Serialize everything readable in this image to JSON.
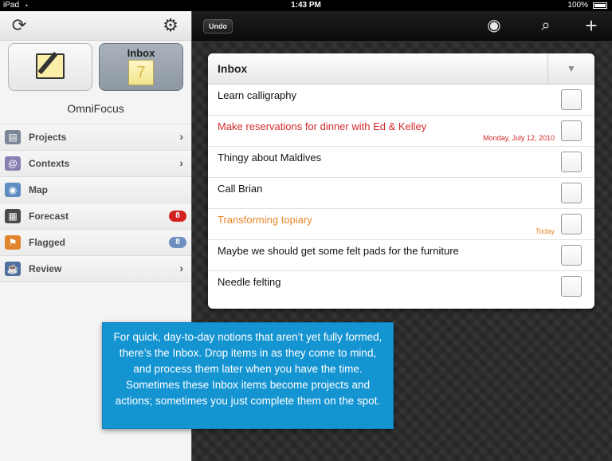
{
  "status_bar": {
    "carrier": "iPad",
    "wifi_icon": "wifi-icon",
    "time": "1:43 PM",
    "battery": "100%"
  },
  "sidebar": {
    "toolbar": {
      "sync_icon": "sync-icon",
      "settings_icon": "gear-icon"
    },
    "tiles": {
      "inbox_label": "Inbox",
      "inbox_count": "7"
    },
    "app_name": "OmniFocus",
    "perspectives": [
      {
        "label": "Projects",
        "icon": "projects-icon",
        "icon_color": "#7a8796",
        "trailing": "chevron"
      },
      {
        "label": "Contexts",
        "icon": "contexts-icon",
        "icon_color": "#8a7fb0",
        "trailing": "chevron"
      },
      {
        "label": "Map",
        "icon": "map-icon",
        "icon_color": "#5f8dc0",
        "trailing": ""
      },
      {
        "label": "Forecast",
        "icon": "forecast-icon",
        "icon_color": "#4a4a4a",
        "badge": "8",
        "badge_color": "#d32020"
      },
      {
        "label": "Flagged",
        "icon": "flag-icon",
        "icon_color": "#e0852e",
        "badge": "8",
        "badge_color": "#6d8fbf"
      },
      {
        "label": "Review",
        "icon": "review-icon",
        "icon_color": "#4f6f9f",
        "trailing": "chevron"
      }
    ]
  },
  "main": {
    "toolbar": {
      "undo_label": "Undo",
      "view_icon": "eye-icon",
      "search_icon": "search-icon",
      "add_icon": "plus-icon"
    },
    "panel": {
      "title": "Inbox",
      "tasks": [
        {
          "title": "Learn calligraphy",
          "date": "",
          "color": "#111111"
        },
        {
          "title": "Make reservations for dinner with Ed & Kelley",
          "date": "Monday, July 12, 2010",
          "color": "#d42a2a"
        },
        {
          "title": "Thingy about Maldives",
          "date": "",
          "color": "#111111"
        },
        {
          "title": "Call Brian",
          "date": "",
          "color": "#111111"
        },
        {
          "title": "Transforming topiary",
          "date": "Today",
          "color": "#e8862a"
        },
        {
          "title": "Maybe we should get some felt pads for the furniture",
          "date": "",
          "color": "#111111"
        },
        {
          "title": "Needle felting",
          "date": "",
          "color": "#111111"
        }
      ]
    }
  },
  "callout": {
    "text": "For quick, day-to-day notions that aren’t yet fully formed, there’s the Inbox. Drop items in as they come to mind, and process them later when you have the time. Sometimes these Inbox items become projects and actions; sometimes you just complete them on the spot.",
    "bg_color": "#1594d2"
  }
}
